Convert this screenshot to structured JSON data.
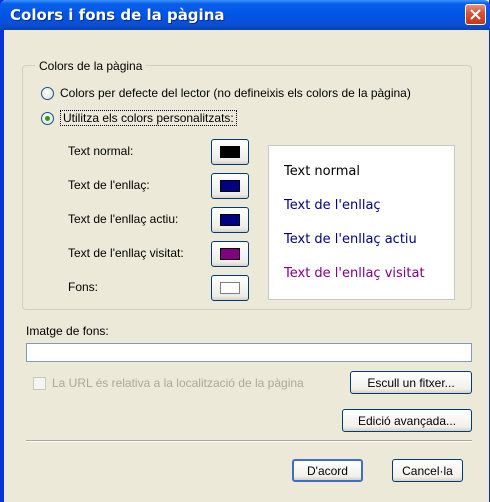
{
  "window": {
    "title": "Colors i fons de la pàgina"
  },
  "group": {
    "legend": "Colors de la pàgina",
    "radio_default": "Colors per defecte del lector (no defineixis els colors de la pàgina)",
    "radio_custom": "Utilitza els colors personalitzats:"
  },
  "colors": [
    {
      "label": "Text normal:",
      "color": "#000000"
    },
    {
      "label": "Text de l'enllaç:",
      "color": "#000080"
    },
    {
      "label": "Text de l'enllaç actiu:",
      "color": "#000080"
    },
    {
      "label": "Text de l'enllaç visitat:",
      "color": "#800080"
    },
    {
      "label": "Fons:",
      "color": "#ffffff"
    }
  ],
  "preview": {
    "normal": "Text normal",
    "link": "Text de l'enllaç",
    "active": "Text de l'enllaç actiu",
    "visited": "Text de l'enllaç visitat"
  },
  "background_image": {
    "label": "Imatge de fons:",
    "value": "",
    "relative_url_label": "La URL és relativa a la localització de la pàgina",
    "choose_file_button": "Escull un fitxer...",
    "advanced_edit_button": "Edició avançada..."
  },
  "footer": {
    "ok_button": "D'acord",
    "cancel_button": "Cancel·la"
  }
}
